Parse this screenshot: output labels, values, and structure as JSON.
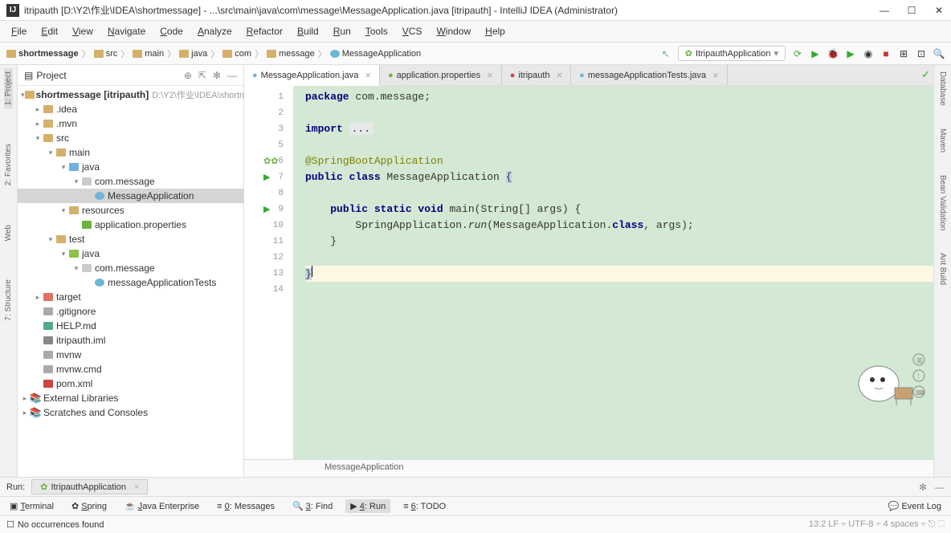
{
  "titlebar": {
    "title": "itripauth [D:\\Y2\\作业\\IDEA\\shortmessage] - ...\\src\\main\\java\\com\\message\\MessageApplication.java [itripauth] - IntelliJ IDEA (Administrator)"
  },
  "menu": [
    "File",
    "Edit",
    "View",
    "Navigate",
    "Code",
    "Analyze",
    "Refactor",
    "Build",
    "Run",
    "Tools",
    "VCS",
    "Window",
    "Help"
  ],
  "breadcrumb": [
    {
      "label": "shortmessage",
      "icon": "folder"
    },
    {
      "label": "src",
      "icon": "folder"
    },
    {
      "label": "main",
      "icon": "folder"
    },
    {
      "label": "java",
      "icon": "folder"
    },
    {
      "label": "com",
      "icon": "folder"
    },
    {
      "label": "message",
      "icon": "folder"
    },
    {
      "label": "MessageApplication",
      "icon": "class"
    }
  ],
  "runConfig": "ItripauthApplication",
  "project": {
    "title": "Project",
    "root": {
      "label": "shortmessage",
      "bold": "[itripauth]",
      "hint": "D:\\Y2\\作业\\IDEA\\shortm"
    },
    "nodes": [
      {
        "indent": 1,
        "arrow": "r",
        "label": ".idea",
        "icon": "folder"
      },
      {
        "indent": 1,
        "arrow": "r",
        "label": ".mvn",
        "icon": "folder"
      },
      {
        "indent": 1,
        "arrow": "d",
        "label": "src",
        "icon": "folder"
      },
      {
        "indent": 2,
        "arrow": "d",
        "label": "main",
        "icon": "folder"
      },
      {
        "indent": 3,
        "arrow": "d",
        "label": "java",
        "icon": "folder-src"
      },
      {
        "indent": 4,
        "arrow": "d",
        "label": "com.message",
        "icon": "package"
      },
      {
        "indent": 5,
        "arrow": "",
        "label": "MessageApplication",
        "icon": "class",
        "selected": true
      },
      {
        "indent": 3,
        "arrow": "d",
        "label": "resources",
        "icon": "folder-res"
      },
      {
        "indent": 4,
        "arrow": "",
        "label": "application.properties",
        "icon": "spring"
      },
      {
        "indent": 2,
        "arrow": "d",
        "label": "test",
        "icon": "folder"
      },
      {
        "indent": 3,
        "arrow": "d",
        "label": "java",
        "icon": "folder-test"
      },
      {
        "indent": 4,
        "arrow": "d",
        "label": "com.message",
        "icon": "package"
      },
      {
        "indent": 5,
        "arrow": "",
        "label": "messageApplicationTests",
        "icon": "class"
      },
      {
        "indent": 1,
        "arrow": "r",
        "label": "target",
        "icon": "folder-excl"
      },
      {
        "indent": 1,
        "arrow": "",
        "label": ".gitignore",
        "icon": "file"
      },
      {
        "indent": 1,
        "arrow": "",
        "label": "HELP.md",
        "icon": "md"
      },
      {
        "indent": 1,
        "arrow": "",
        "label": "itripauth.iml",
        "icon": "iml"
      },
      {
        "indent": 1,
        "arrow": "",
        "label": "mvnw",
        "icon": "file"
      },
      {
        "indent": 1,
        "arrow": "",
        "label": "mvnw.cmd",
        "icon": "file"
      },
      {
        "indent": 1,
        "arrow": "",
        "label": "pom.xml",
        "icon": "maven"
      }
    ],
    "extLibs": "External Libraries",
    "scratches": "Scratches and Consoles"
  },
  "editorTabs": [
    {
      "label": "MessageApplication.java",
      "icon": "class",
      "active": true
    },
    {
      "label": "application.properties",
      "icon": "spring"
    },
    {
      "label": "itripauth",
      "icon": "maven"
    },
    {
      "label": "messageApplicationTests.java",
      "icon": "class"
    }
  ],
  "gutter": [
    {
      "num": "1"
    },
    {
      "num": "2"
    },
    {
      "num": "3"
    },
    {
      "num": "5"
    },
    {
      "num": "6",
      "icon": "spring2"
    },
    {
      "num": "7",
      "icon": "run"
    },
    {
      "num": "8"
    },
    {
      "num": "9",
      "icon": "run"
    },
    {
      "num": "10"
    },
    {
      "num": "11"
    },
    {
      "num": "12"
    },
    {
      "num": "13"
    },
    {
      "num": "14"
    }
  ],
  "code": {
    "l1_kw": "package",
    "l1_rest": " com.message;",
    "l3_kw": "import",
    "l3_rest": "...",
    "l6": "@SpringBootApplication",
    "l7_kw": "public class",
    "l7_name": " MessageApplication ",
    "l7_brace": "{",
    "l9_pre": "    ",
    "l9_kw": "public static void",
    "l9_rest": " main(String[] args) {",
    "l10_pre": "        SpringApplication.",
    "l10_fn": "run",
    "l10_mid": "(MessageApplication.",
    "l10_kw": "class",
    "l10_end": ", args);",
    "l11": "    }",
    "l13": "}"
  },
  "breadcrumbFooter": "MessageApplication",
  "leftTabs": [
    "1: Project",
    "2: Favorites",
    "Web",
    "7: Structure"
  ],
  "rightTabs": [
    "Database",
    "Maven",
    "Bean Validation",
    "Ant Build"
  ],
  "runBar": {
    "label": "Run:",
    "tab": "ItripauthApplication"
  },
  "bottomTabs": [
    {
      "label": "Terminal",
      "icon": "▣"
    },
    {
      "label": "Spring",
      "icon": "✿"
    },
    {
      "label": "Java Enterprise",
      "icon": "☕"
    },
    {
      "label": "0: Messages",
      "icon": "≡"
    },
    {
      "label": "3: Find",
      "icon": "🔍"
    },
    {
      "label": "4: Run",
      "icon": "▶",
      "active": true
    },
    {
      "label": "6: TODO",
      "icon": "≡"
    }
  ],
  "eventLog": "Event Log",
  "statusbar": {
    "msg": "No occurrences found",
    "right": "13:2   LF ÷   UTF-8 ÷   4 spaces ÷  ⎋  ⬚"
  }
}
